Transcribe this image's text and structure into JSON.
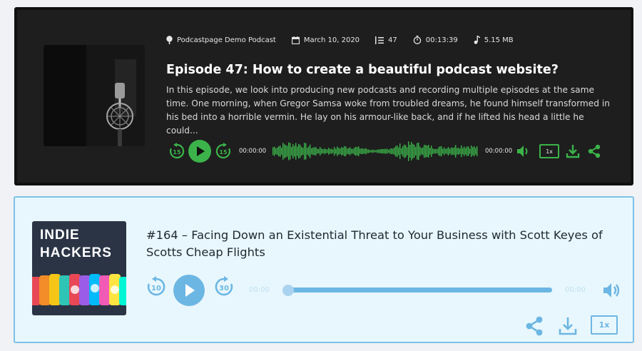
{
  "player1": {
    "podcast": "Podcastpage Demo Podcast",
    "date": "March 10, 2020",
    "episode_number": "47",
    "duration": "00:13:39",
    "size": "5.15 MB",
    "title": "Episode 47: How to create a beautiful podcast website?",
    "description": "In this episode, we look into producing new podcasts and recording multiple episodes at the same time. One morning, when Gregor Samsa woke from troubled dreams, he found himself transformed in his bed into a horrible vermin. He lay on his armour-like back, and if he lifted his head a little he could...",
    "current_time": "00:00:00",
    "total_time": "00:00:00",
    "speed": "1x",
    "rewind_seconds": "15",
    "forward_seconds": "15",
    "accent_color": "#3bb34a"
  },
  "player2": {
    "cover_title_line1": "INDIE",
    "cover_title_line2": "HACKERS",
    "title": "#164 – Facing Down an Existential Threat to Your Business with Scott Keyes of Scotts Cheap Flights",
    "current_time": "00:00",
    "total_time": "00:00",
    "speed": "1x",
    "rewind_seconds": "10",
    "forward_seconds": "30",
    "progress": 0,
    "accent_color": "#6cb6e3"
  }
}
